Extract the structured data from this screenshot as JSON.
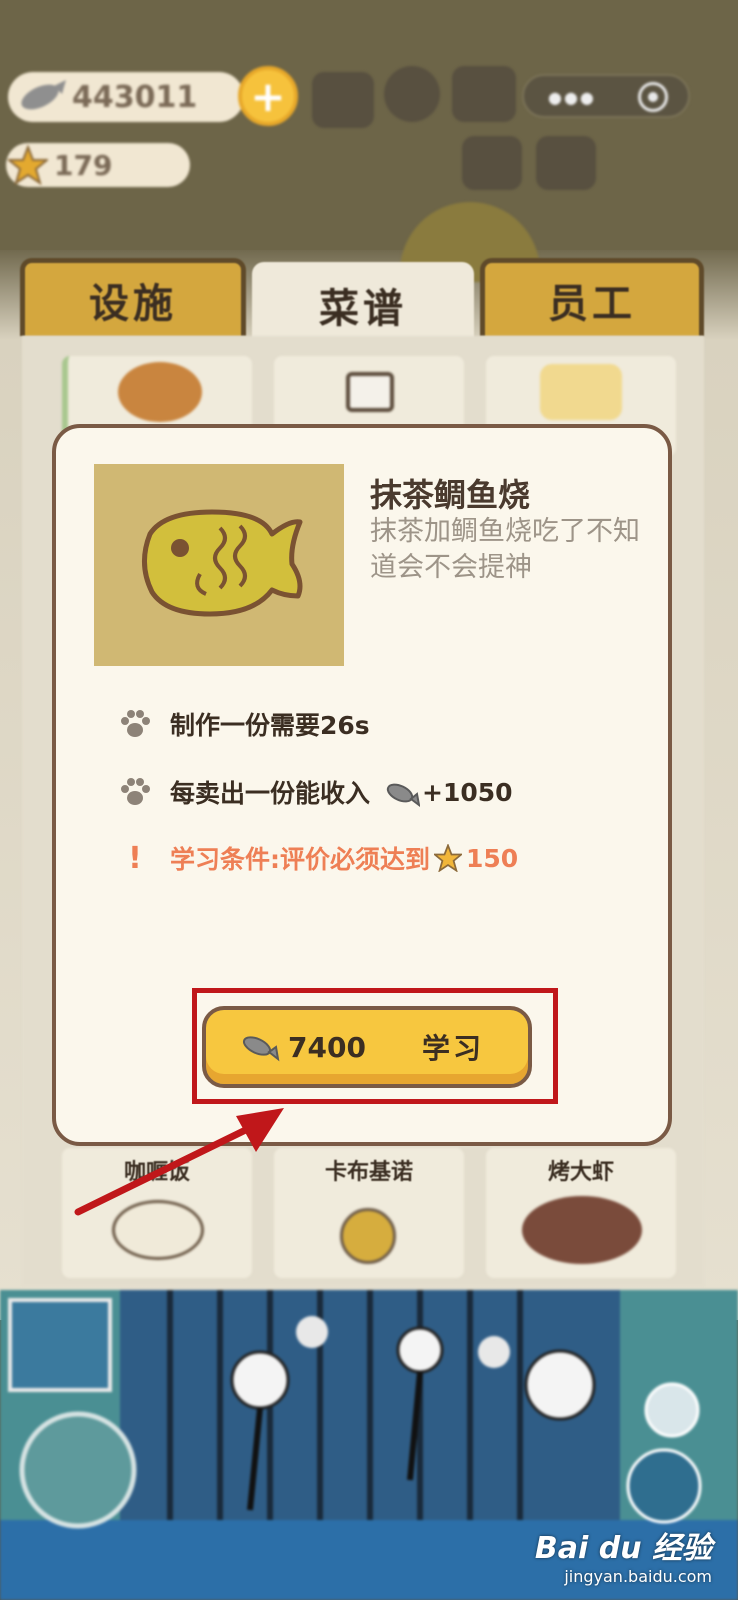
{
  "hud": {
    "fish_currency": "443011",
    "star_rating": "179",
    "plus_label": "+"
  },
  "tabs": [
    {
      "label": "设施",
      "active": false
    },
    {
      "label": "菜谱",
      "active": true
    },
    {
      "label": "员工",
      "active": false
    }
  ],
  "menu_cards": {
    "bottom_labels": [
      "咖喱饭",
      "卡布基诺",
      "烤大虾"
    ]
  },
  "dialog": {
    "dish_name": "抹茶鲷鱼烧",
    "dish_description": "抹茶加鲷鱼烧吃了不知道会不会提神",
    "make_time": "制作一份需要26s",
    "income_prefix": "每卖出一份能收入",
    "income_value": "+1050",
    "requirement_prefix": "学习条件:评价必须达到",
    "requirement_value": "150",
    "learn_cost": "7400",
    "learn_label": "学习"
  },
  "colors": {
    "accent_yellow": "#f7c73f",
    "requirement_text": "#ee7f55",
    "highlight_box": "#c0171a",
    "dialog_border": "#7a5a45"
  },
  "watermark": {
    "logo": "Bai du 经验",
    "url": "jingyan.baidu.com"
  }
}
